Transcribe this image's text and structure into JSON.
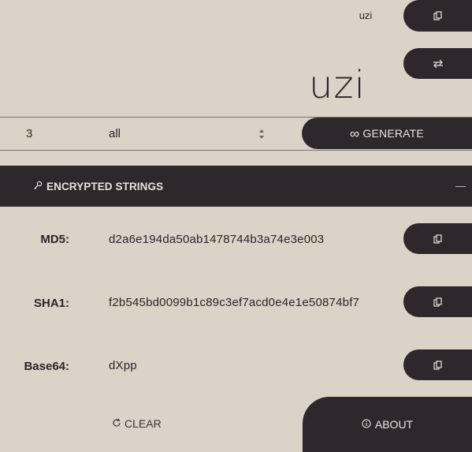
{
  "header": {
    "word_label": "uzi",
    "big_word": "uzi",
    "copy_button_icon": "copy-icon",
    "swap_button_icon": "swap-icon"
  },
  "controls": {
    "count_value": "3",
    "type_selected": "all",
    "generate_label": "GENERATE",
    "generate_icon_glyph": "∞"
  },
  "encrypted": {
    "title": "ENCRYPTED STRINGS",
    "title_icon": "key-icon",
    "rows": [
      {
        "label": "MD5:",
        "value": "d2a6e194da50ab1478744b3a74e3e003"
      },
      {
        "label": "SHA1:",
        "value": "f2b545bd0099b1c89c3ef7acd0e4e1e50874bf7"
      },
      {
        "label": "Base64:",
        "value": "dXpp"
      }
    ]
  },
  "footer": {
    "clear_label": "CLEAR",
    "about_label": "ABOUT"
  },
  "colors": {
    "background": "#d9d3c8",
    "dark": "#2e282d",
    "light_text": "#e9e3d8"
  }
}
